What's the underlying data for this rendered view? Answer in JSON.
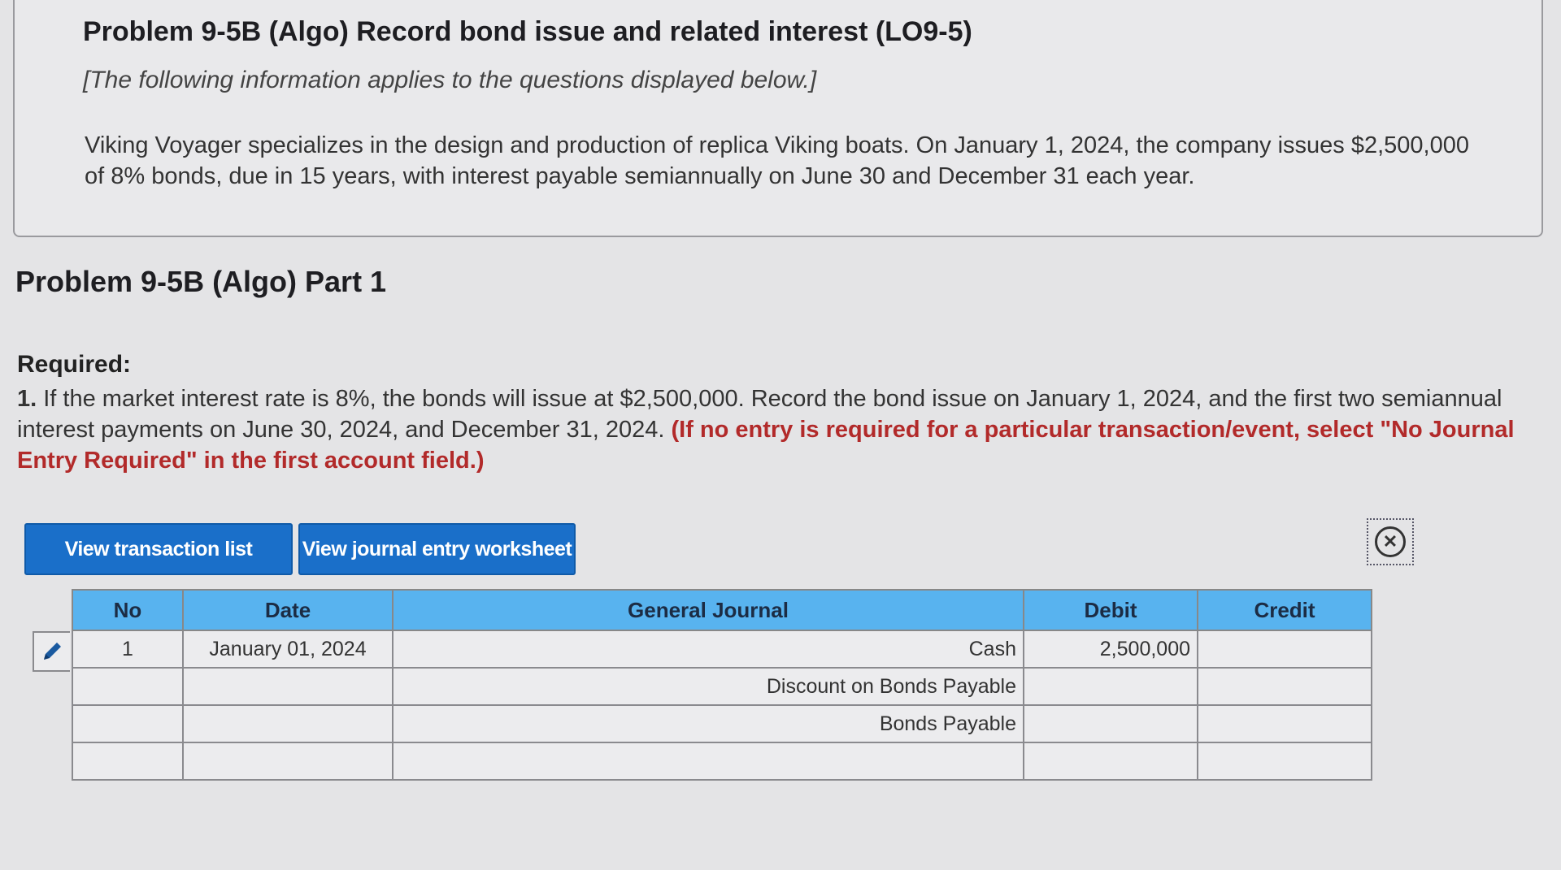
{
  "header": {
    "title": "Problem 9-5B (Algo) Record bond issue and related interest (LO9-5)",
    "subtitle": "[The following information applies to the questions displayed below.]",
    "body": "Viking Voyager specializes in the design and production of replica Viking boats. On January 1, 2024, the company issues $2,500,000 of 8% bonds, due in 15 years, with interest payable semiannually on June 30 and December 31 each year."
  },
  "part": {
    "title": "Problem 9-5B (Algo) Part 1"
  },
  "required": {
    "heading": "Required:",
    "number": "1.",
    "text": "If the market interest rate is 8%, the bonds will issue at $2,500,000. Record the bond issue on January 1, 2024, and the first two semiannual interest payments on June 30, 2024, and December 31, 2024.",
    "instruction": "(If no entry is required for a particular transaction/event, select \"No Journal Entry Required\" in the first account field.)"
  },
  "buttons": {
    "view_transaction_list": "View transaction list",
    "view_journal_worksheet": "View journal entry worksheet"
  },
  "icons": {
    "edit": "pencil-icon",
    "close": "close-circle-icon"
  },
  "journal": {
    "headers": {
      "no": "No",
      "date": "Date",
      "general_journal": "General Journal",
      "debit": "Debit",
      "credit": "Credit"
    },
    "rows": [
      {
        "no": "1",
        "date": "January 01, 2024",
        "account": "Cash",
        "debit": "2,500,000",
        "credit": ""
      },
      {
        "no": "",
        "date": "",
        "account": "Discount on Bonds Payable",
        "debit": "",
        "credit": ""
      },
      {
        "no": "",
        "date": "",
        "account": "Bonds Payable",
        "debit": "",
        "credit": ""
      },
      {
        "no": "",
        "date": "",
        "account": "",
        "debit": "",
        "credit": ""
      }
    ]
  },
  "colors": {
    "button_bg": "#1a6fc9",
    "table_header_bg": "#58b3ef",
    "instruction_red": "#b22a2a"
  }
}
